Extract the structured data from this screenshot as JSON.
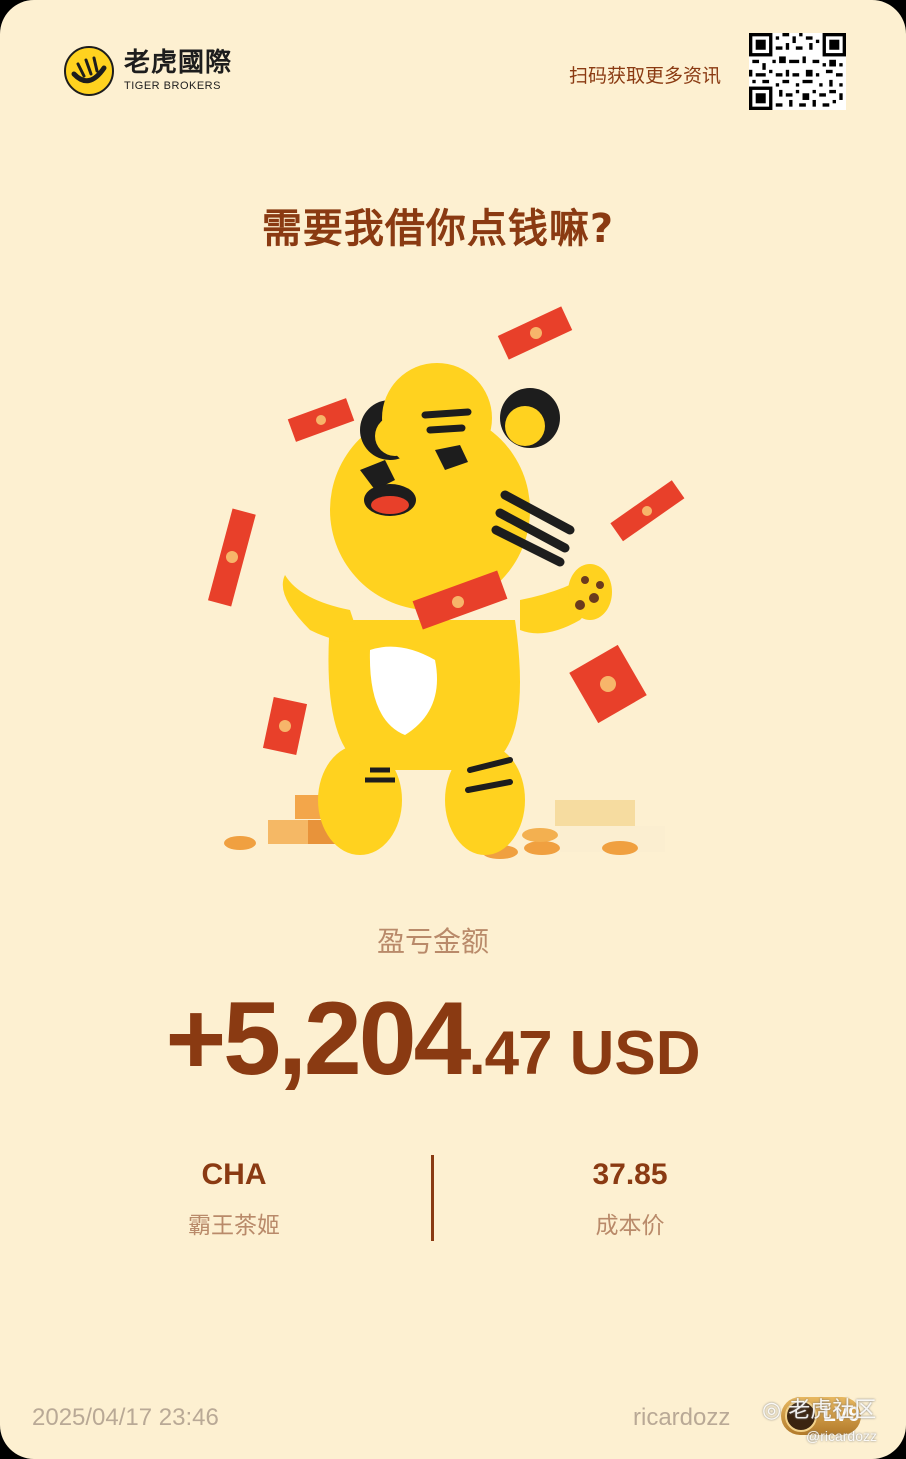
{
  "brand": {
    "name_cn": "老虎國際",
    "name_en": "TIGER BROKERS"
  },
  "header": {
    "scan_text": "扫码获取更多资讯"
  },
  "headline": "需要我借你点钱嘛?",
  "pnl": {
    "label": "盈亏金额",
    "amount_main": "+5,204",
    "amount_decimal": ".47",
    "currency": "USD"
  },
  "stock": {
    "symbol": "CHA",
    "name": "霸王茶姬"
  },
  "cost": {
    "value": "37.85",
    "label": "成本价"
  },
  "footer": {
    "datetime": "2025/04/17 23:46",
    "username": "ricardozz",
    "level": "LV9"
  },
  "watermark": {
    "text": "老虎社区",
    "handle": "@ricardozz"
  },
  "colors": {
    "background": "#fdf0d1",
    "primary": "#8a3a12",
    "muted": "#b98a6a",
    "tiger": "#ffd21f"
  }
}
